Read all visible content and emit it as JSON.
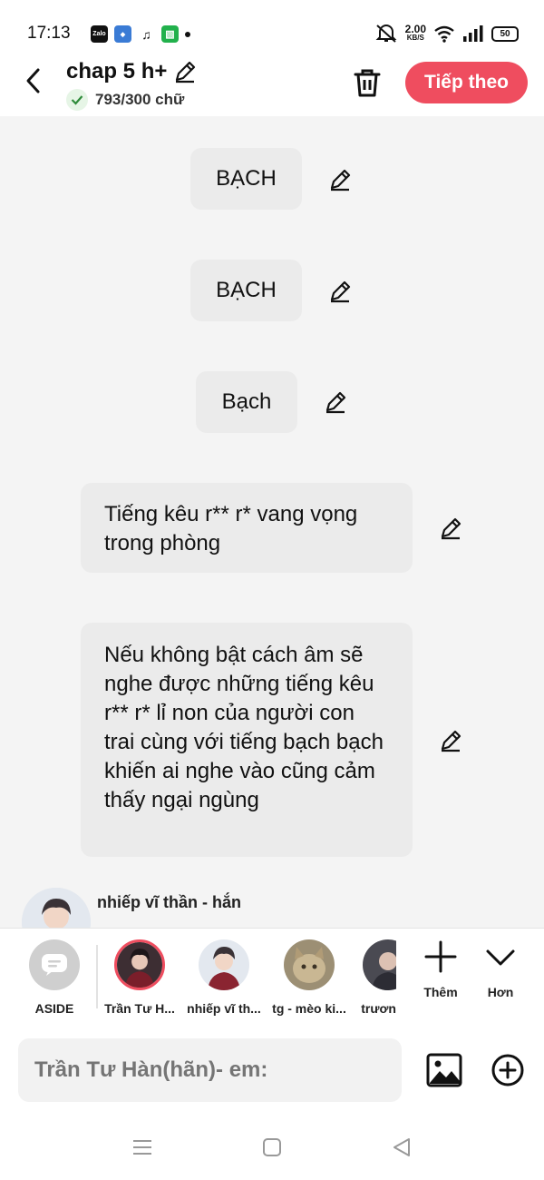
{
  "status_bar": {
    "time": "17:13",
    "app_icons": [
      "zalo-icon",
      "blue-app-icon",
      "tiktok-icon",
      "green-app-icon"
    ],
    "zalo_label": "Zalo",
    "net_speed_value": "2.00",
    "net_speed_unit": "KB/S",
    "battery": "50"
  },
  "header": {
    "title": "chap 5 h+",
    "word_count": "793/300 chữ",
    "next_label": "Tiếp theo",
    "accent_color": "#ef4d5f"
  },
  "messages": [
    {
      "text": "BẠCH"
    },
    {
      "text": "BẠCH"
    },
    {
      "text": "Bạch"
    },
    {
      "text": "Tiếng kêu r** r* vang vọng trong phòng"
    },
    {
      "text": "Nếu không bật cách âm sẽ nghe được những tiếng kêu r** r* lỉ non của người con trai cùng với tiếng bạch bạch khiến ai nghe vào cũng cảm thấy ngại ngùng"
    }
  ],
  "peek": {
    "name": "nhiếp vĩ thần - hắn"
  },
  "characters": [
    {
      "label": "ASIDE"
    },
    {
      "label": "Trần Tư H..."
    },
    {
      "label": "nhiếp vĩ th..."
    },
    {
      "label": "tg - mèo ki..."
    },
    {
      "label": "trươn"
    }
  ],
  "tools": {
    "add_label": "Thêm",
    "more_label": "Hơn"
  },
  "input": {
    "placeholder": "Trần Tư Hàn(hãn)- em:"
  }
}
